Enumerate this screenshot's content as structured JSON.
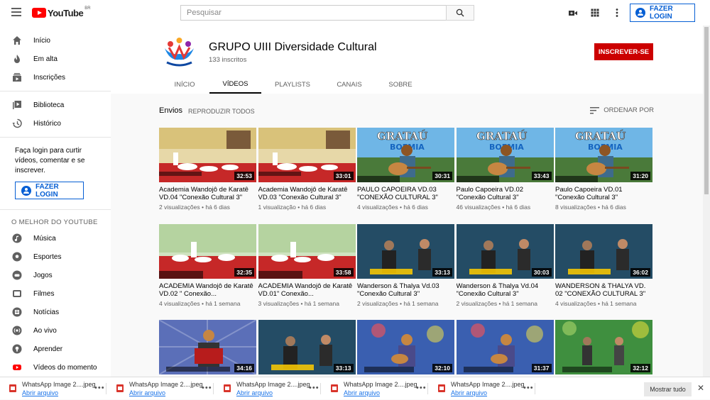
{
  "header": {
    "logo_text": "YouTube",
    "logo_region": "BR",
    "search_placeholder": "Pesquisar",
    "login_label": "FAZER LOGIN"
  },
  "sidebar": {
    "main_items": [
      {
        "label": "Início",
        "icon": "home-icon"
      },
      {
        "label": "Em alta",
        "icon": "fire-icon"
      },
      {
        "label": "Inscrições",
        "icon": "subscriptions-icon"
      }
    ],
    "library_items": [
      {
        "label": "Biblioteca",
        "icon": "library-icon"
      },
      {
        "label": "Histórico",
        "icon": "history-icon"
      }
    ],
    "login_prompt": "Faça login para curtir vídeos, comentar e se inscrever.",
    "login_label": "FAZER LOGIN",
    "best_heading": "O MELHOR DO YOUTUBE",
    "best_items": [
      {
        "label": "Música",
        "icon": "music-icon"
      },
      {
        "label": "Esportes",
        "icon": "sports-icon"
      },
      {
        "label": "Jogos",
        "icon": "gaming-icon"
      },
      {
        "label": "Filmes",
        "icon": "movies-icon"
      },
      {
        "label": "Notícias",
        "icon": "news-icon"
      },
      {
        "label": "Ao vivo",
        "icon": "live-icon"
      },
      {
        "label": "Aprender",
        "icon": "learning-icon"
      },
      {
        "label": "Vídeos do momento",
        "icon": "trending-video-icon"
      }
    ]
  },
  "channel": {
    "name": "GRUPO UIII Diversidade Cultural",
    "subscribers": "133 inscritos",
    "subscribe_label": "INSCREVER-SE",
    "tabs": [
      "INÍCIO",
      "VÍDEOS",
      "PLAYLISTS",
      "CANAIS",
      "SOBRE"
    ],
    "active_tab": "VÍDEOS"
  },
  "section": {
    "title": "Envios",
    "play_all": "REPRODUZIR TODOS",
    "sort_label": "ORDENAR POR"
  },
  "videos": [
    {
      "title": "Academia Wandojô de Karatê VD.04 \"Conexão Cultural 3\"",
      "meta": "2 visualizações • há 6 dias",
      "duration": "32:53",
      "thumb": "karate-red"
    },
    {
      "title": "Academia Wandojô de Karatê VD.03 \"Conexão Cultural 3\"",
      "meta": "1 visualização • há 6 dias",
      "duration": "33:01",
      "thumb": "karate-red"
    },
    {
      "title": "PAULO CAPOEIRA VD.03 \"CONEXÃO CULTURAL 3\"",
      "meta": "4 visualizações • há 6 dias",
      "duration": "30:31",
      "thumb": "guitar-blue"
    },
    {
      "title": "Paulo Capoeira VD.02 \"Conexão Cultural 3\"",
      "meta": "46 visualizações • há 6 dias",
      "duration": "33:43",
      "thumb": "guitar-blue"
    },
    {
      "title": "Paulo Capoeira VD.01 \"Conexão Cultural 3\"",
      "meta": "8 visualizações • há 6 dias",
      "duration": "31:20",
      "thumb": "guitar-blue"
    },
    {
      "title": "ACADEMIA Wandojô de Karatê VD.02 \" Conexão...",
      "meta": "4 visualizações • há 1 semana",
      "duration": "32:35",
      "thumb": "karate-green"
    },
    {
      "title": "ACADEMIA Wandojô de Karatê VD.01\" Conexão...",
      "meta": "3 visualizações • há 1 semana",
      "duration": "33:58",
      "thumb": "karate-green"
    },
    {
      "title": "Wanderson & Thalya Vd.03 \"Conexão Cultural 3\"",
      "meta": "2 visualizações • há 1 semana",
      "duration": "33:13",
      "thumb": "duo-dark"
    },
    {
      "title": "Wanderson & Thalya Vd.04 \"Conexão Cultural 3\"",
      "meta": "2 visualizações • há 1 semana",
      "duration": "30:03",
      "thumb": "duo-dark"
    },
    {
      "title": "WANDERSON & THALYA VD. 02 \"CONEXÃO CULTURAL 3\"",
      "meta": "4 visualizações • há 1 semana",
      "duration": "36:02",
      "thumb": "duo-dark"
    },
    {
      "title": "",
      "meta": "",
      "duration": "34:16",
      "thumb": "accordion"
    },
    {
      "title": "",
      "meta": "",
      "duration": "33:13",
      "thumb": "duo-dark"
    },
    {
      "title": "",
      "meta": "",
      "duration": "32:10",
      "thumb": "colorful"
    },
    {
      "title": "",
      "meta": "",
      "duration": "31:37",
      "thumb": "colorful"
    },
    {
      "title": "",
      "meta": "",
      "duration": "32:12",
      "thumb": "green-band"
    }
  ],
  "downloads": {
    "items": [
      {
        "name": "WhatsApp Image 2....jpeg",
        "open": "Abrir arquivo"
      },
      {
        "name": "WhatsApp Image 2....jpeg",
        "open": "Abrir arquivo"
      },
      {
        "name": "WhatsApp Image 2....jpeg",
        "open": "Abrir arquivo"
      },
      {
        "name": "WhatsApp Image 2....jpeg",
        "open": "Abrir arquivo"
      },
      {
        "name": "WhatsApp Image 2....jpeg",
        "open": "Abrir arquivo"
      }
    ],
    "show_all": "Mostrar tudo"
  },
  "colors": {
    "brand_red": "#ff0000",
    "subscribe_red": "#cc0000",
    "link_blue": "#065fd4"
  }
}
